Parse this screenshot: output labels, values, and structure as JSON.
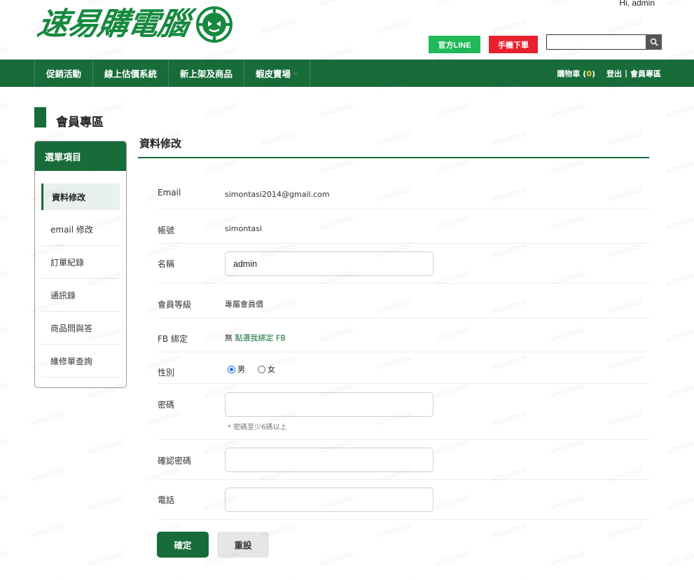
{
  "header": {
    "greeting": "Hi, admin",
    "logo_text": "速易購電腦",
    "line_button": "官方LINE",
    "mobile_button": "手機下單",
    "search_placeholder": "",
    "colors": {
      "brand_green": "#176c3a",
      "logo_green": "#16893f",
      "line_green": "#1fba59",
      "mobile_red": "#e8202d"
    }
  },
  "nav": {
    "items": [
      {
        "label": "促銷活動"
      },
      {
        "label": "線上估價系統"
      },
      {
        "label": "新上架及商品"
      },
      {
        "label": "蝦皮賣場",
        "has_dropdown": true
      }
    ],
    "cart_label": "購物車",
    "cart_count": "0",
    "logout_label": "登出",
    "member_label": "會員專區"
  },
  "page": {
    "title": "會員專區"
  },
  "sidebar": {
    "heading": "選單項目",
    "items": [
      {
        "label": "資料修改",
        "active": true
      },
      {
        "label": "email 修改"
      },
      {
        "label": "訂單紀錄"
      },
      {
        "label": "通訊錄"
      },
      {
        "label": "商品問與答"
      },
      {
        "label": "維修單查詢"
      }
    ]
  },
  "form": {
    "title": "資料修改",
    "email_label": "Email",
    "email_value": "simontasi2014@gmail.com",
    "account_label": "帳號",
    "account_value": "simontasi",
    "name_label": "名稱",
    "name_value": "admin",
    "level_label": "會員等級",
    "level_value": "專屬會員價",
    "fb_label": "FB 綁定",
    "fb_status": "無",
    "fb_link": "點選我綁定 FB",
    "gender_label": "性別",
    "gender_male": "男",
    "gender_female": "女",
    "gender_selected": "男",
    "password_label": "密碼",
    "password_hint": "* 密碼至少6碼以上",
    "confirm_password_label": "確認密碼",
    "phone_label": "電話",
    "confirm_button": "確定",
    "reset_button": "重設"
  },
  "watermark_text": "simontasi"
}
